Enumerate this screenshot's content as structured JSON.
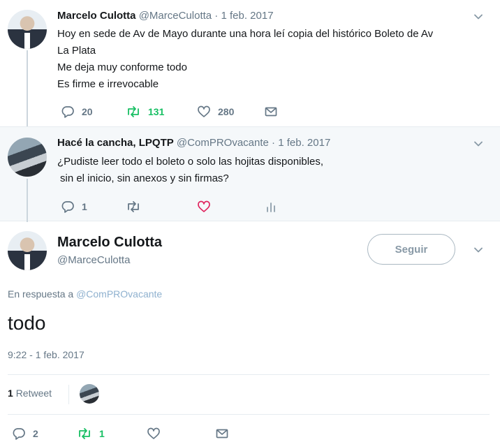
{
  "tweet1": {
    "name": "Marcelo Culotta",
    "handle": "@MarceCulotta",
    "sep": "·",
    "date": "1 feb. 2017",
    "lines": [
      "Hoy en sede de Av de Mayo durante una hora leí copia del histórico Boleto de Av",
      "La Plata",
      "Me deja muy conforme todo",
      "Es firme e irrevocable"
    ],
    "replies": "20",
    "retweets": "131",
    "likes": "280"
  },
  "tweet2": {
    "name": "Hacé la cancha, LPQTP",
    "handle": "@ComPROvacante",
    "sep": "·",
    "date": "1 feb. 2017",
    "lines": [
      "¿Pudiste leer todo el boleto o solo las hojitas disponibles,",
      "sin el inicio, sin anexos y sin firmas?"
    ],
    "replies": "1"
  },
  "main": {
    "name": "Marcelo Culotta",
    "handle": "@MarceCulotta",
    "follow_label": "Seguir",
    "reply_prefix": "En respuesta a",
    "reply_mention": "@ComPROvacante",
    "text": "todo",
    "timestamp": "9:22 - 1 feb. 2017",
    "retweet_count": "1",
    "retweet_label": "Retweet",
    "replies": "2",
    "retweets": "1"
  },
  "colors": {
    "retweet_active": "#17bf63",
    "like_outline_active": "#e0245e",
    "secondary_text": "#657786"
  },
  "icons": [
    "reply-icon",
    "retweet-icon",
    "like-icon",
    "dm-icon",
    "analytics-icon",
    "chevron-down-icon"
  ]
}
